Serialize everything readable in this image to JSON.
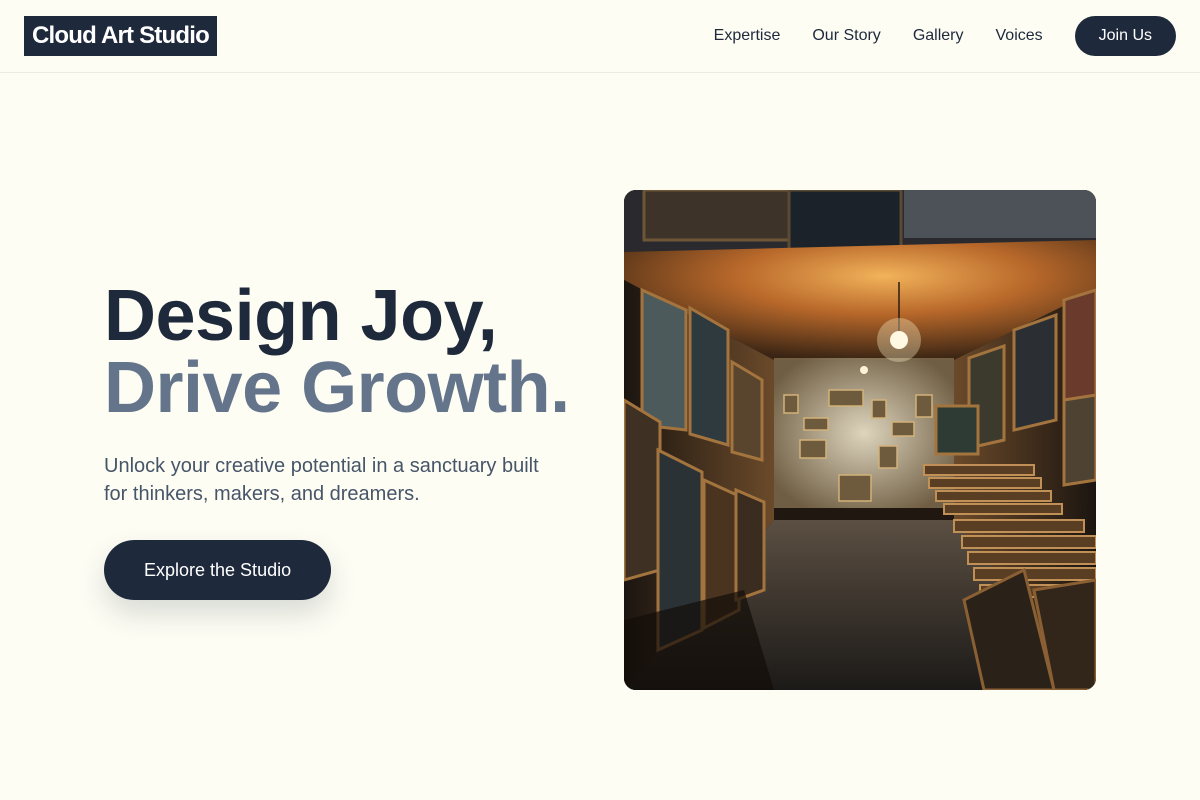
{
  "header": {
    "logo": "Cloud Art Studio",
    "nav": [
      {
        "label": "Expertise"
      },
      {
        "label": "Our Story"
      },
      {
        "label": "Gallery"
      },
      {
        "label": "Voices"
      }
    ],
    "cta_label": "Join Us"
  },
  "hero": {
    "headline_line1": "Design Joy,",
    "headline_line2": "Drive Growth.",
    "subtitle": "Unlock your creative potential in a sanctuary built for thinkers, makers, and dreamers.",
    "cta_label": "Explore the Studio",
    "image": {
      "semantic": "art-studio-photo"
    }
  },
  "colors": {
    "background": "#fdfdf4",
    "primary": "#1e293b",
    "muted_heading": "#64748b",
    "body_text": "#475569"
  }
}
